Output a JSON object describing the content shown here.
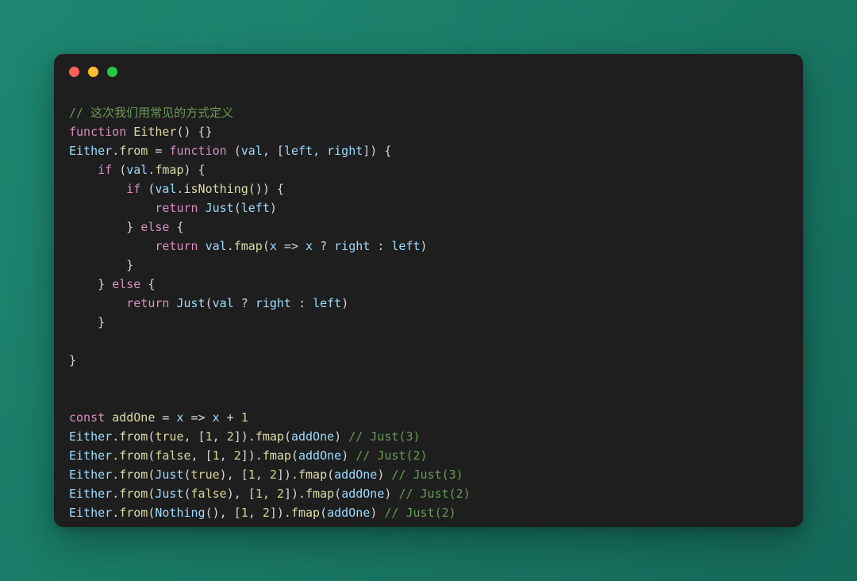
{
  "window": {
    "traffic_lights": [
      {
        "name": "close-button",
        "color": "#ff5f57"
      },
      {
        "name": "minimize-button",
        "color": "#febc2e"
      },
      {
        "name": "maximize-button",
        "color": "#28c840"
      }
    ]
  },
  "theme": {
    "page_background": "#1b7c68",
    "code_background": "#1e1e1e",
    "comment": "#6a9955",
    "keyword": "#d98ec0",
    "function": "#dcdcaa",
    "identifier": "#9cdcfe",
    "number": "#d7d79a",
    "plain": "#d6d6d6"
  },
  "code": {
    "language": "javascript",
    "plain_text": "// 这次我们用常见的方式定义\nfunction Either() {}\nEither.from = function (val, [left, right]) {\n    if (val.fmap) {\n        if (val.isNothing()) {\n            return Just(left)\n        } else {\n            return val.fmap(x => x ? right : left)\n        }\n    } else {\n        return Just(val ? right : left)\n    }\n\n}\n\nconst addOne = x => x + 1\nEither.from(true, [1, 2]).fmap(addOne) // Just(3)\nEither.from(false, [1, 2]).fmap(addOne) // Just(2)\nEither.from(Just(true), [1, 2]).fmap(addOne) // Just(3)\nEither.from(Just(false), [1, 2]).fmap(addOne) // Just(2)\nEither.from(Nothing(), [1, 2]).fmap(addOne) // Just(2)",
    "lines": [
      {
        "tokens": [
          {
            "t": "// 这次我们用常见的方式定义",
            "c": "comment"
          }
        ]
      },
      {
        "tokens": [
          {
            "t": "function ",
            "c": "keyword"
          },
          {
            "t": "Either",
            "c": "func"
          },
          {
            "t": "() {}",
            "c": "plain"
          }
        ]
      },
      {
        "tokens": [
          {
            "t": "Either",
            "c": "ident"
          },
          {
            "t": ".",
            "c": "plain"
          },
          {
            "t": "from",
            "c": "func"
          },
          {
            "t": " = ",
            "c": "plain"
          },
          {
            "t": "function ",
            "c": "keyword"
          },
          {
            "t": "(",
            "c": "plain"
          },
          {
            "t": "val",
            "c": "ident"
          },
          {
            "t": ", [",
            "c": "plain"
          },
          {
            "t": "left",
            "c": "ident"
          },
          {
            "t": ", ",
            "c": "plain"
          },
          {
            "t": "right",
            "c": "ident"
          },
          {
            "t": "]) {",
            "c": "plain"
          }
        ]
      },
      {
        "tokens": [
          {
            "t": "    ",
            "c": "plain"
          },
          {
            "t": "if",
            "c": "keyword"
          },
          {
            "t": " (",
            "c": "plain"
          },
          {
            "t": "val",
            "c": "ident"
          },
          {
            "t": ".",
            "c": "plain"
          },
          {
            "t": "fmap",
            "c": "func"
          },
          {
            "t": ") {",
            "c": "plain"
          }
        ]
      },
      {
        "tokens": [
          {
            "t": "        ",
            "c": "plain"
          },
          {
            "t": "if",
            "c": "keyword"
          },
          {
            "t": " (",
            "c": "plain"
          },
          {
            "t": "val",
            "c": "ident"
          },
          {
            "t": ".",
            "c": "plain"
          },
          {
            "t": "isNothing",
            "c": "func"
          },
          {
            "t": "()) {",
            "c": "plain"
          }
        ]
      },
      {
        "tokens": [
          {
            "t": "            ",
            "c": "plain"
          },
          {
            "t": "return",
            "c": "keyword"
          },
          {
            "t": " ",
            "c": "plain"
          },
          {
            "t": "Just",
            "c": "ident"
          },
          {
            "t": "(",
            "c": "plain"
          },
          {
            "t": "left",
            "c": "ident"
          },
          {
            "t": ")",
            "c": "plain"
          }
        ]
      },
      {
        "tokens": [
          {
            "t": "        } ",
            "c": "plain"
          },
          {
            "t": "else",
            "c": "keyword"
          },
          {
            "t": " {",
            "c": "plain"
          }
        ]
      },
      {
        "tokens": [
          {
            "t": "            ",
            "c": "plain"
          },
          {
            "t": "return",
            "c": "keyword"
          },
          {
            "t": " ",
            "c": "plain"
          },
          {
            "t": "val",
            "c": "ident"
          },
          {
            "t": ".",
            "c": "plain"
          },
          {
            "t": "fmap",
            "c": "func"
          },
          {
            "t": "(",
            "c": "plain"
          },
          {
            "t": "x",
            "c": "ident"
          },
          {
            "t": " => ",
            "c": "plain"
          },
          {
            "t": "x",
            "c": "ident"
          },
          {
            "t": " ? ",
            "c": "plain"
          },
          {
            "t": "right",
            "c": "ident"
          },
          {
            "t": " : ",
            "c": "plain"
          },
          {
            "t": "left",
            "c": "ident"
          },
          {
            "t": ")",
            "c": "plain"
          }
        ]
      },
      {
        "tokens": [
          {
            "t": "        }",
            "c": "plain"
          }
        ]
      },
      {
        "tokens": [
          {
            "t": "    } ",
            "c": "plain"
          },
          {
            "t": "else",
            "c": "keyword"
          },
          {
            "t": " {",
            "c": "plain"
          }
        ]
      },
      {
        "tokens": [
          {
            "t": "        ",
            "c": "plain"
          },
          {
            "t": "return",
            "c": "keyword"
          },
          {
            "t": " ",
            "c": "plain"
          },
          {
            "t": "Just",
            "c": "ident"
          },
          {
            "t": "(",
            "c": "plain"
          },
          {
            "t": "val",
            "c": "ident"
          },
          {
            "t": " ? ",
            "c": "plain"
          },
          {
            "t": "right",
            "c": "ident"
          },
          {
            "t": " : ",
            "c": "plain"
          },
          {
            "t": "left",
            "c": "ident"
          },
          {
            "t": ")",
            "c": "plain"
          }
        ]
      },
      {
        "tokens": [
          {
            "t": "    }",
            "c": "plain"
          }
        ]
      },
      {
        "tokens": []
      },
      {
        "tokens": [
          {
            "t": "}",
            "c": "plain"
          }
        ]
      },
      {
        "tokens": []
      },
      {
        "tokens": []
      },
      {
        "tokens": [
          {
            "t": "const",
            "c": "keyword"
          },
          {
            "t": " ",
            "c": "plain"
          },
          {
            "t": "addOne",
            "c": "func"
          },
          {
            "t": " = ",
            "c": "plain"
          },
          {
            "t": "x",
            "c": "ident"
          },
          {
            "t": " => ",
            "c": "plain"
          },
          {
            "t": "x",
            "c": "ident"
          },
          {
            "t": " + ",
            "c": "plain"
          },
          {
            "t": "1",
            "c": "num"
          }
        ]
      },
      {
        "tokens": [
          {
            "t": "Either",
            "c": "ident"
          },
          {
            "t": ".",
            "c": "plain"
          },
          {
            "t": "from",
            "c": "func"
          },
          {
            "t": "(",
            "c": "plain"
          },
          {
            "t": "true",
            "c": "num"
          },
          {
            "t": ", [",
            "c": "plain"
          },
          {
            "t": "1",
            "c": "num"
          },
          {
            "t": ", ",
            "c": "plain"
          },
          {
            "t": "2",
            "c": "num"
          },
          {
            "t": "]).",
            "c": "plain"
          },
          {
            "t": "fmap",
            "c": "func"
          },
          {
            "t": "(",
            "c": "plain"
          },
          {
            "t": "addOne",
            "c": "ident"
          },
          {
            "t": ") ",
            "c": "plain"
          },
          {
            "t": "// Just(3)",
            "c": "comment"
          }
        ]
      },
      {
        "tokens": [
          {
            "t": "Either",
            "c": "ident"
          },
          {
            "t": ".",
            "c": "plain"
          },
          {
            "t": "from",
            "c": "func"
          },
          {
            "t": "(",
            "c": "plain"
          },
          {
            "t": "false",
            "c": "num"
          },
          {
            "t": ", [",
            "c": "plain"
          },
          {
            "t": "1",
            "c": "num"
          },
          {
            "t": ", ",
            "c": "plain"
          },
          {
            "t": "2",
            "c": "num"
          },
          {
            "t": "]).",
            "c": "plain"
          },
          {
            "t": "fmap",
            "c": "func"
          },
          {
            "t": "(",
            "c": "plain"
          },
          {
            "t": "addOne",
            "c": "ident"
          },
          {
            "t": ") ",
            "c": "plain"
          },
          {
            "t": "// Just(2)",
            "c": "comment"
          }
        ]
      },
      {
        "tokens": [
          {
            "t": "Either",
            "c": "ident"
          },
          {
            "t": ".",
            "c": "plain"
          },
          {
            "t": "from",
            "c": "func"
          },
          {
            "t": "(",
            "c": "plain"
          },
          {
            "t": "Just",
            "c": "ident"
          },
          {
            "t": "(",
            "c": "plain"
          },
          {
            "t": "true",
            "c": "num"
          },
          {
            "t": "), [",
            "c": "plain"
          },
          {
            "t": "1",
            "c": "num"
          },
          {
            "t": ", ",
            "c": "plain"
          },
          {
            "t": "2",
            "c": "num"
          },
          {
            "t": "]).",
            "c": "plain"
          },
          {
            "t": "fmap",
            "c": "func"
          },
          {
            "t": "(",
            "c": "plain"
          },
          {
            "t": "addOne",
            "c": "ident"
          },
          {
            "t": ") ",
            "c": "plain"
          },
          {
            "t": "// Just(3)",
            "c": "comment"
          }
        ]
      },
      {
        "tokens": [
          {
            "t": "Either",
            "c": "ident"
          },
          {
            "t": ".",
            "c": "plain"
          },
          {
            "t": "from",
            "c": "func"
          },
          {
            "t": "(",
            "c": "plain"
          },
          {
            "t": "Just",
            "c": "ident"
          },
          {
            "t": "(",
            "c": "plain"
          },
          {
            "t": "false",
            "c": "num"
          },
          {
            "t": "), [",
            "c": "plain"
          },
          {
            "t": "1",
            "c": "num"
          },
          {
            "t": ", ",
            "c": "plain"
          },
          {
            "t": "2",
            "c": "num"
          },
          {
            "t": "]).",
            "c": "plain"
          },
          {
            "t": "fmap",
            "c": "func"
          },
          {
            "t": "(",
            "c": "plain"
          },
          {
            "t": "addOne",
            "c": "ident"
          },
          {
            "t": ") ",
            "c": "plain"
          },
          {
            "t": "// Just(2)",
            "c": "comment"
          }
        ]
      },
      {
        "tokens": [
          {
            "t": "Either",
            "c": "ident"
          },
          {
            "t": ".",
            "c": "plain"
          },
          {
            "t": "from",
            "c": "func"
          },
          {
            "t": "(",
            "c": "plain"
          },
          {
            "t": "Nothing",
            "c": "ident"
          },
          {
            "t": "(), [",
            "c": "plain"
          },
          {
            "t": "1",
            "c": "num"
          },
          {
            "t": ", ",
            "c": "plain"
          },
          {
            "t": "2",
            "c": "num"
          },
          {
            "t": "]).",
            "c": "plain"
          },
          {
            "t": "fmap",
            "c": "func"
          },
          {
            "t": "(",
            "c": "plain"
          },
          {
            "t": "addOne",
            "c": "ident"
          },
          {
            "t": ") ",
            "c": "plain"
          },
          {
            "t": "// Just(2)",
            "c": "comment"
          }
        ]
      }
    ]
  }
}
